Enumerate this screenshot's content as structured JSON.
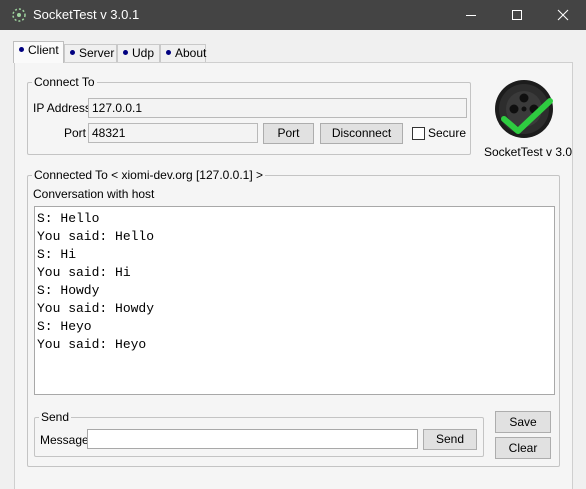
{
  "window": {
    "title": "SocketTest v 3.0.1"
  },
  "tabs": [
    {
      "label": "Client",
      "active": true
    },
    {
      "label": "Server",
      "active": false
    },
    {
      "label": "Udp",
      "active": false
    },
    {
      "label": "About",
      "active": false
    }
  ],
  "connect_to": {
    "legend": "Connect To",
    "ip_label": "IP Address",
    "ip_value": "127.0.0.1",
    "port_label": "Port",
    "port_value": "48321",
    "port_button": "Port",
    "disconnect_button": "Disconnect",
    "secure_label": "Secure",
    "secure_checked": false
  },
  "logo": {
    "caption": "SocketTest v 3.0",
    "accent_color": "#2ecc40"
  },
  "connected": {
    "legend": "Connected To <  xiomi-dev.org [127.0.0.1]  >",
    "conversation_label": "Conversation with host",
    "lines": [
      "S: Hello",
      "You said: Hello",
      "S: Hi",
      "You said: Hi",
      "S: Howdy",
      "You said: Howdy",
      "S: Heyo",
      "You said: Heyo"
    ]
  },
  "send": {
    "legend": "Send",
    "message_label": "Message",
    "message_value": "",
    "send_button": "Send"
  },
  "actions": {
    "save_button": "Save",
    "clear_button": "Clear"
  }
}
